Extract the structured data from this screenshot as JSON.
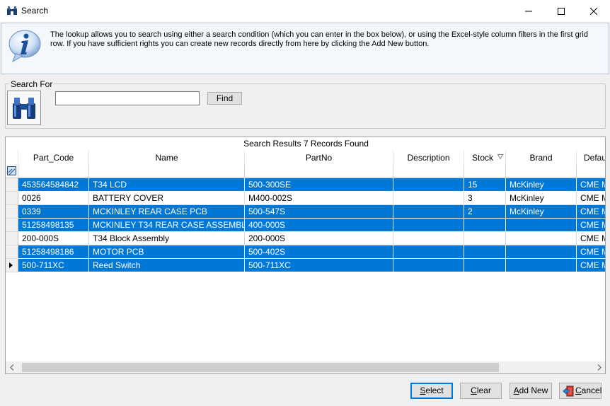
{
  "window": {
    "title": "Search"
  },
  "info": {
    "message": "The lookup allows you to search using either a search condition (which you can enter in the box below), or using the Excel-style column filters in the first grid row. If you have sufficient rights you can create new records directly from here by clicking the Add New button."
  },
  "search": {
    "group_label": "Search For",
    "value": "",
    "find_label": "Find"
  },
  "grid": {
    "caption": "Search Results 7 Records Found",
    "columns": [
      "Part_Code",
      "Name",
      "PartNo",
      "Description",
      "Stock",
      "Brand",
      "Defaul"
    ],
    "rows": [
      {
        "part_code": "453564584842",
        "name": "T34 LCD",
        "partno": "500-300SE",
        "description": "",
        "stock": "15",
        "brand": "McKinley",
        "default": "CME M"
      },
      {
        "part_code": "0026",
        "name": "BATTERY COVER",
        "partno": "M400-002S",
        "description": "",
        "stock": "3",
        "brand": "McKinley",
        "default": "CME M"
      },
      {
        "part_code": "0339",
        "name": "MCKINLEY REAR CASE PCB",
        "partno": "500-547S",
        "description": "",
        "stock": "2",
        "brand": "McKinley",
        "default": "CME M"
      },
      {
        "part_code": "51258498135",
        "name": "MCKINLEY T34 REAR CASE ASSEMBL",
        "partno": "400-000S",
        "description": "",
        "stock": "",
        "brand": "",
        "default": "CME M"
      },
      {
        "part_code": "200-000S",
        "name": "T34 Block Assembly",
        "partno": "200-000S",
        "description": "",
        "stock": "",
        "brand": "",
        "default": "CME M"
      },
      {
        "part_code": "51258498186",
        "name": "MOTOR PCB",
        "partno": "500-402S",
        "description": "",
        "stock": "",
        "brand": "",
        "default": "CME M"
      },
      {
        "part_code": "500-711XC",
        "name": "Reed Switch",
        "partno": "500-711XC",
        "description": "",
        "stock": "",
        "brand": "",
        "default": "CME M"
      }
    ],
    "selected_rows": [
      0,
      2,
      3,
      5,
      6
    ],
    "current_row": 6
  },
  "buttons": {
    "select": "Select",
    "clear": "Clear",
    "add_new": "Add New",
    "cancel": "Cancel"
  },
  "colors": {
    "selection": "#0078d7",
    "info_background": "#f4f7fc"
  }
}
